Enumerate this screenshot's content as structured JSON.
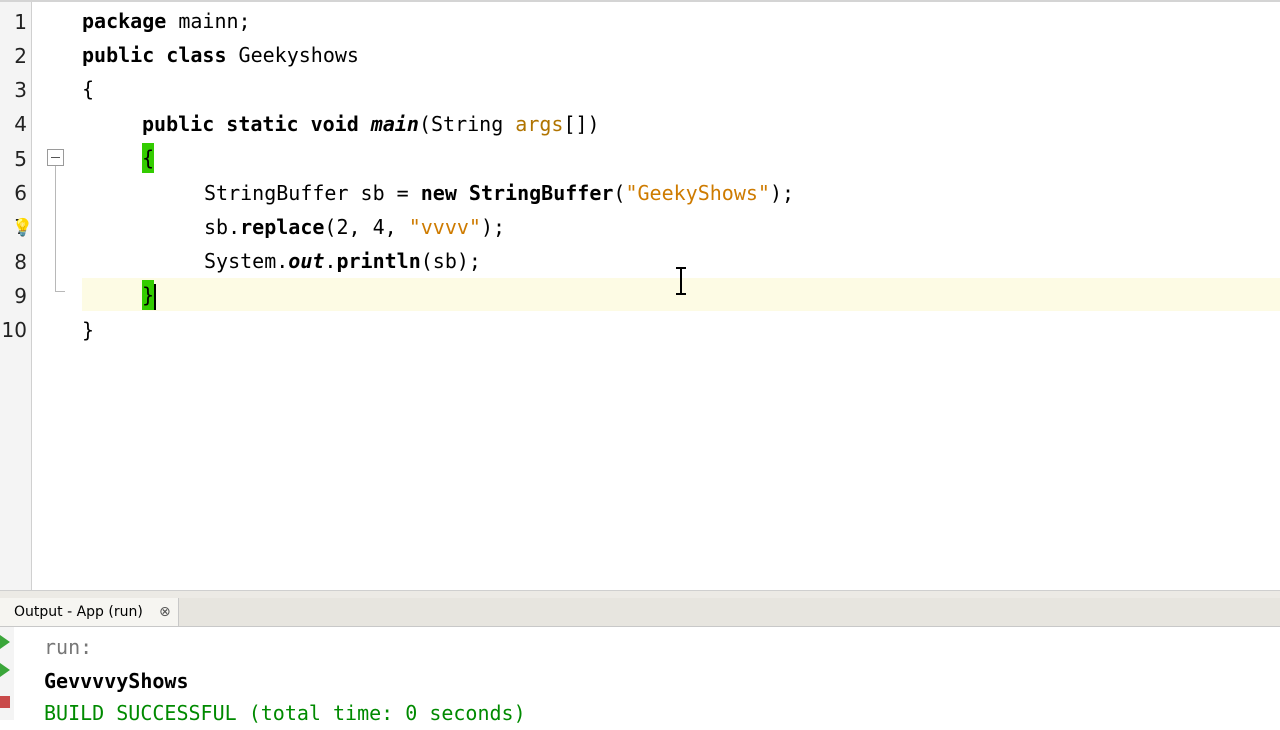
{
  "editor": {
    "line_numbers": [
      "1",
      "2",
      "3",
      "4",
      "5",
      "6",
      "7",
      "8",
      "9",
      "10"
    ],
    "code": {
      "l1_kw": "package",
      "l1_rest": " mainn;",
      "l2_kw": "public class",
      "l2_rest": " Geekyshows",
      "l3": "{",
      "l4_kw": "public static void",
      "l4_method": "main",
      "l4_open": "(String ",
      "l4_param": "args",
      "l4_close": "[])",
      "l5": "{",
      "l6_a": "StringBuffer sb = ",
      "l6_kw": "new",
      "l6_cls": " StringBuffer",
      "l6_paren": "(",
      "l6_str": "\"GeekyShows\"",
      "l6_end": ");",
      "l7_a": "sb.",
      "l7_method": "replace",
      "l7_args": "(2, 4, ",
      "l7_str": "\"vvvv\"",
      "l7_end": ");",
      "l8_a": "System.",
      "l8_field": "out",
      "l8_dot": ".",
      "l8_method": "println",
      "l8_end": "(sb);",
      "l9": "}",
      "l10": "}"
    }
  },
  "output": {
    "tab_label": "Output - App (run)",
    "close_glyph": "⊗",
    "lines": {
      "run": "run:",
      "result": "GevvvvyShows",
      "build": "BUILD SUCCESSFUL (total time: 0 seconds)"
    }
  },
  "icons": {
    "bulb": "lightbulb-icon",
    "fold": "fold-toggle-icon"
  },
  "colors": {
    "brace_highlight": "#33cc00",
    "current_line": "#fdfbe4",
    "string": "#ce7b00",
    "success": "#008a00"
  }
}
